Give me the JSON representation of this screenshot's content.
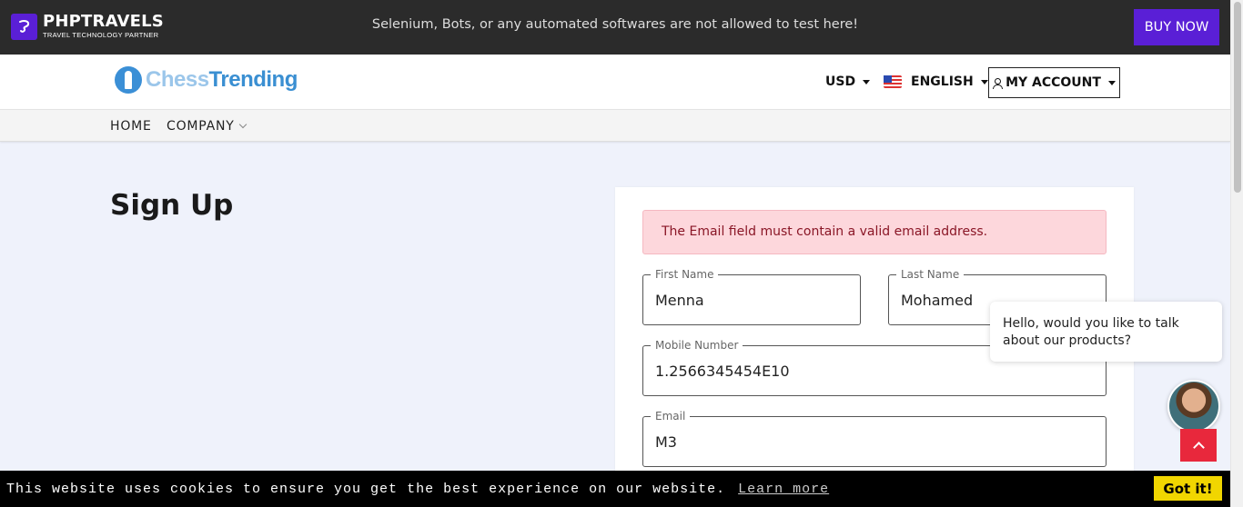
{
  "topbar": {
    "brand_name": "PHPTRAVELS",
    "brand_tagline": "TRAVEL TECHNOLOGY PARTNER",
    "notice": "Selenium, Bots, or any automated softwares are not allowed to test here!",
    "buy_now_label": "BUY NOW"
  },
  "header": {
    "logo_text_part1": "Chess",
    "logo_text_part2": "Trending",
    "currency": "USD",
    "language": "ENGLISH",
    "account_label": "MY ACCOUNT"
  },
  "nav": {
    "home": "HOME",
    "company": "COMPANY"
  },
  "main": {
    "title": "Sign Up",
    "alert": "The Email field must contain a valid email address.",
    "fields": {
      "first_name": {
        "label": "First Name",
        "value": "Menna"
      },
      "last_name": {
        "label": "Last Name",
        "value": "Mohamed"
      },
      "mobile": {
        "label": "Mobile Number",
        "value": "1.2566345454E10"
      },
      "email": {
        "label": "Email",
        "value": "M3"
      }
    }
  },
  "chat": {
    "message": "Hello, would you like to talk about our products?"
  },
  "cookie": {
    "text": "This website uses cookies to ensure you get the best experience on our website.",
    "link": "Learn more",
    "button": "Got it!"
  },
  "colors": {
    "topbar_bg": "#2b2b2b",
    "brand_purple": "#5a1fd6",
    "alert_bg": "#fdd7dc",
    "scroll_top_red": "#e8283c",
    "cookie_button": "#f1d600"
  }
}
